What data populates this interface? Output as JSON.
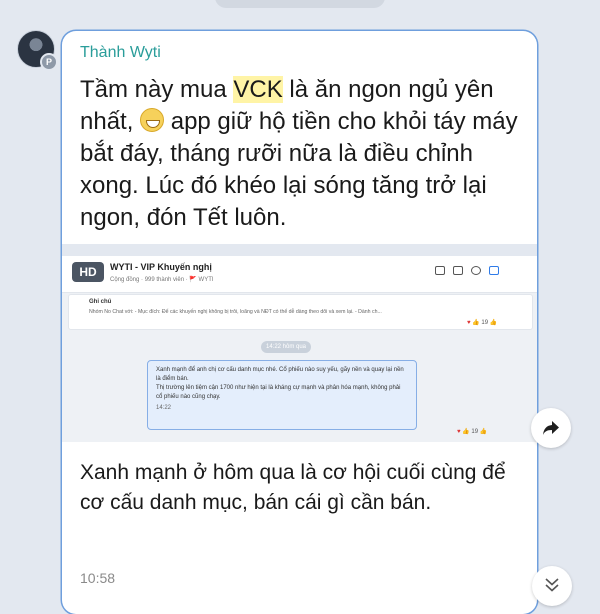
{
  "message": {
    "sender": "Thành Wyti",
    "avatar_badge": "P",
    "text_before": "Tầm này mua ",
    "highlight": "VCK",
    "text_mid": " là ăn ngon ngủ yên nhất, ",
    "text_after": " app giữ hộ tiền cho khỏi táy máy bắt đáy, tháng rưỡi nữa là điều chỉnh xong. Lúc đó khéo lại sóng tăng trở lại ngon, đón Tết luôn.",
    "caption": "Xanh mạnh ở hôm qua là cơ hội cuối cùng để cơ cấu danh mục, bán cái gì cần bán.",
    "time": "10:58"
  },
  "screenshot": {
    "hd_badge": "HD",
    "title": "WYTI - VIP Khuyến nghị",
    "subtitle": "Cộng đồng · 999 thành viên · 🚩 WYTI",
    "note_title": "Ghi chú",
    "note_body": "Nhóm No Chat với: - Mục đích: Để các khuyến nghị không bị trôi, loãng và NĐT có thể dễ dàng theo dõi và xem lại. - Dành ch...",
    "note_reaction": "19",
    "time_pill": "14:22 hôm qua",
    "msg_line1": "Xanh mạnh để anh chị cơ cấu danh mục nhé. Cổ phiếu nào suy yếu, gãy nền và quay lại nền là điểm bán.",
    "msg_line2": "Thị trường lên tiệm cận 1700 như hiện tại là kháng cự mạnh và phân hóa mạnh, không phải cổ phiếu nào cũng chạy.",
    "msg_time": "14:22",
    "msg_reaction": "19"
  },
  "icons": {
    "share": "share-arrow-icon",
    "scroll": "double-chevron-down-icon",
    "emoji": "grinning-face-icon"
  }
}
